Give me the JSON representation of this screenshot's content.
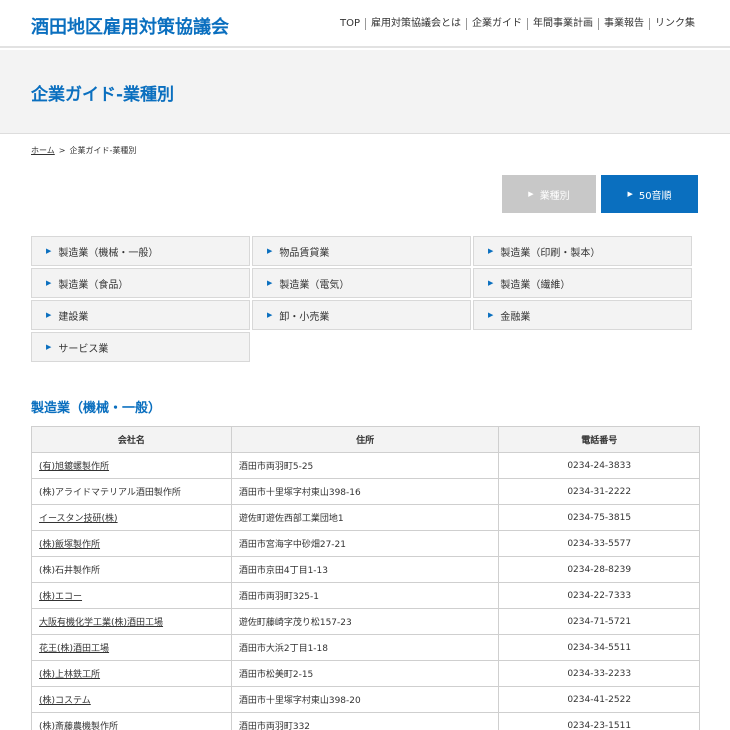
{
  "header": {
    "site_title": "酒田地区雇用対策協議会",
    "nav": [
      {
        "label": "TOP"
      },
      {
        "label": "雇用対策協議会とは"
      },
      {
        "label": "企業ガイド"
      },
      {
        "label": "年間事業計画"
      },
      {
        "label": "事業報告"
      },
      {
        "label": "リンク集"
      }
    ]
  },
  "page": {
    "title": "企業ガイド-業種別"
  },
  "breadcrumb": {
    "home": "ホーム",
    "separator": ">",
    "current": "企業ガイド-業種別"
  },
  "sort_buttons": {
    "by_category": "業種別",
    "by_kana": "50音順"
  },
  "categories": [
    {
      "label": "製造業（機械・一般）"
    },
    {
      "label": "物品賃貸業"
    },
    {
      "label": "製造業（印刷・製本）"
    },
    {
      "label": "製造業（食品）"
    },
    {
      "label": "製造業（電気）"
    },
    {
      "label": "製造業（繊維）"
    },
    {
      "label": "建設業"
    },
    {
      "label": "卸・小売業"
    },
    {
      "label": "金融業"
    },
    {
      "label": "サービス業"
    }
  ],
  "section": {
    "title": "製造業（機械・一般）"
  },
  "table": {
    "headers": {
      "name": "会社名",
      "address": "住所",
      "tel": "電話番号"
    },
    "rows": [
      {
        "name": "(有)旭鍍螺製作所",
        "address": "酒田市両羽町5-25",
        "tel": "0234-24-3833",
        "link": true
      },
      {
        "name": "(株)アライドマテリアル酒田製作所",
        "address": "酒田市十里塚字村東山398-16",
        "tel": "0234-31-2222",
        "link": false
      },
      {
        "name": "イースタン技研(株)",
        "address": "遊佐町遊佐西部工業団地1",
        "tel": "0234-75-3815",
        "link": true
      },
      {
        "name": "(株)飯塚製作所",
        "address": "酒田市宮海字中砂畑27-21",
        "tel": "0234-33-5577",
        "link": true
      },
      {
        "name": "(株)石井製作所",
        "address": "酒田市京田4丁目1-13",
        "tel": "0234-28-8239",
        "link": false
      },
      {
        "name": "(株)エコー",
        "address": "酒田市両羽町325-1",
        "tel": "0234-22-7333",
        "link": true
      },
      {
        "name": "大阪有機化学工業(株)酒田工場",
        "address": "遊佐町藤崎字茂り松157-23",
        "tel": "0234-71-5721",
        "link": true
      },
      {
        "name": "花王(株)酒田工場",
        "address": "酒田市大浜2丁目1-18",
        "tel": "0234-34-5511",
        "link": true
      },
      {
        "name": "(株)上林鉄工所",
        "address": "酒田市松美町2-15",
        "tel": "0234-33-2233",
        "link": true
      },
      {
        "name": "(株)コステム",
        "address": "酒田市十里塚字村東山398-20",
        "tel": "0234-41-2522",
        "link": true
      },
      {
        "name": "(株)斎藤農機製作所",
        "address": "酒田市両羽町332",
        "tel": "0234-23-1511",
        "link": false
      }
    ]
  },
  "colors": {
    "accent": "#0a6fbf",
    "button_inactive": "#c8c8c8",
    "panel_bg": "#f3f3f3"
  }
}
